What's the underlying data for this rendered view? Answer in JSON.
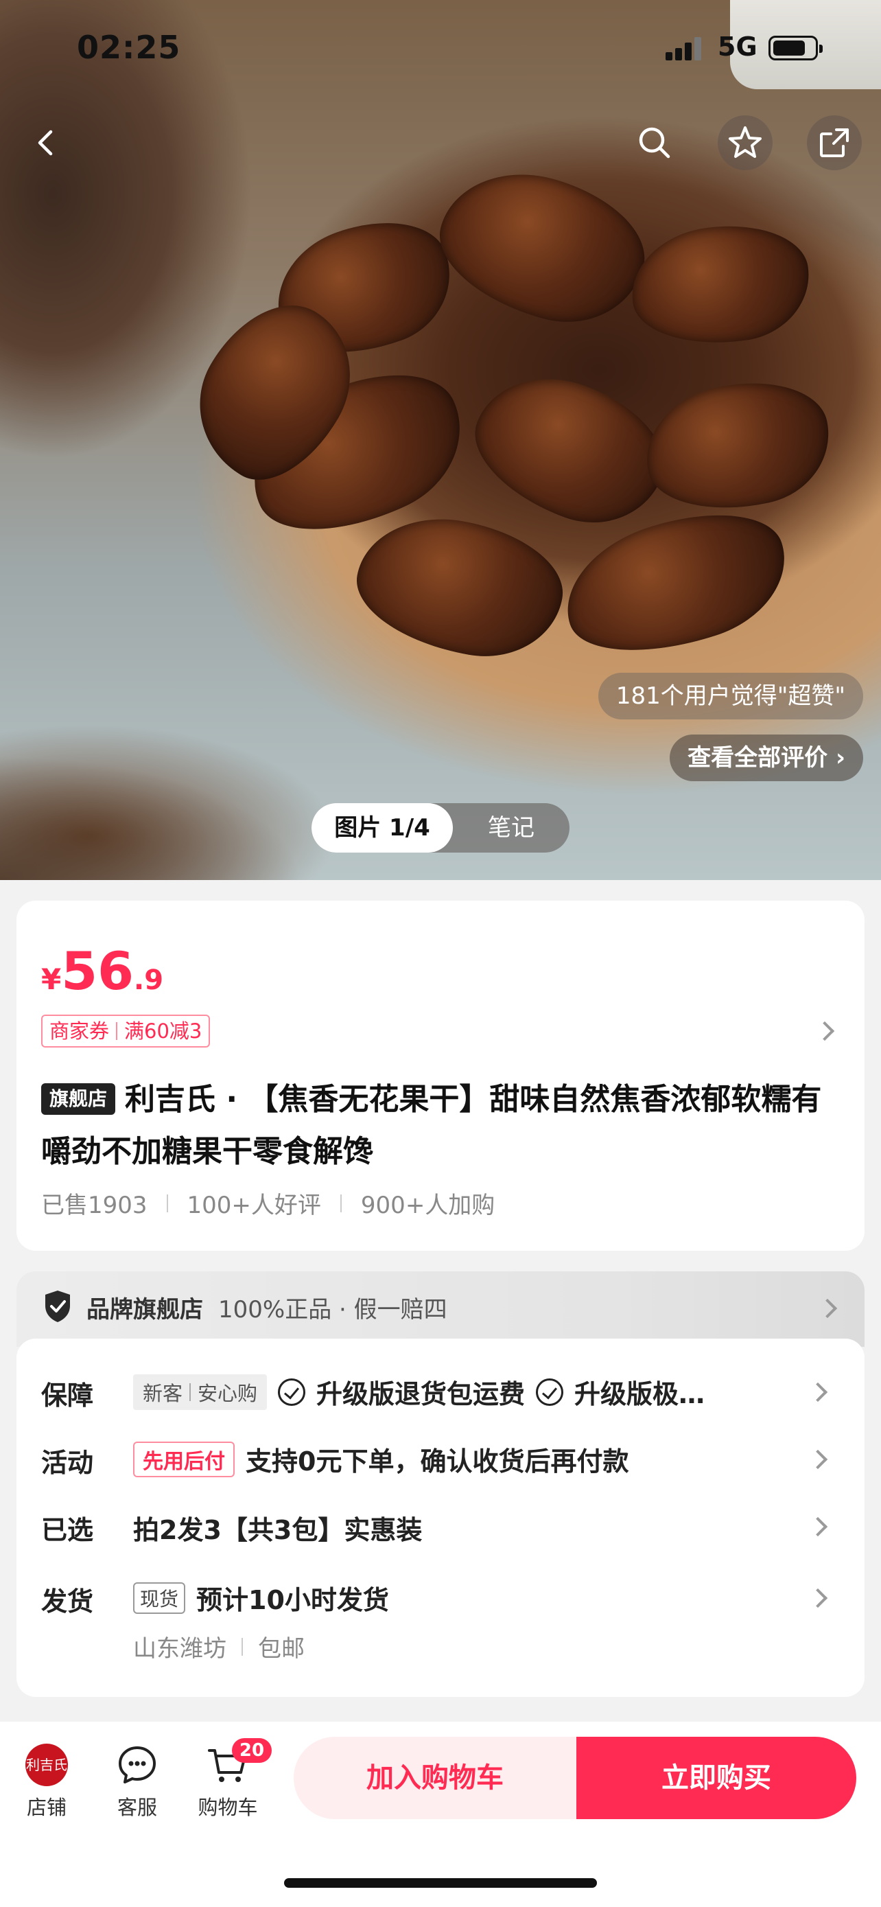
{
  "status_bar": {
    "time": "02:25",
    "network": "5G",
    "battery_level": 0.8
  },
  "media": {
    "praise_text": "181个用户觉得\"超赞\"",
    "reviews_link": "查看全部评价 ›",
    "tab_photo": "图片 1/4",
    "tab_notes": "笔记"
  },
  "product": {
    "price_currency": "¥",
    "price_int": "56",
    "price_dec": ".9",
    "coupon_label": "商家券",
    "coupon_value": "满60减3",
    "store_flag": "旗舰店",
    "title": "利吉氏 · 【焦香无花果干】甜味自然焦香浓郁软糯有嚼劲不加糖果干零食解馋",
    "sold": "已售1903",
    "good_reviews": "100+人好评",
    "added_to_cart": "900+人加购"
  },
  "brand_banner": {
    "label": "品牌旗舰店",
    "sub": "100%正品 · 假一赔四"
  },
  "info": {
    "guarantee": {
      "label": "保障",
      "tag_a": "新客",
      "tag_b": "安心购",
      "item1": "升级版退货包运费",
      "item2": "升级版极…"
    },
    "activity": {
      "label": "活动",
      "tag": "先用后付",
      "text": "支持0元下单，确认收货后再付款"
    },
    "selected": {
      "label": "已选",
      "text": "拍2发3【共3包】实惠装"
    },
    "shipping": {
      "label": "发货",
      "tag": "现货",
      "text": "预计10小时发货",
      "origin": "山东潍坊",
      "shipping_fee": "包邮"
    }
  },
  "bottom_bar": {
    "store_logo_text": "利吉氏",
    "store": "店铺",
    "service": "客服",
    "cart": "购物车",
    "cart_count": "20",
    "add_to_cart": "加入购物车",
    "buy_now": "立即购买"
  },
  "colors": {
    "accent": "#ff2b52",
    "accent_soft": "#ffeef0"
  },
  "icons": [
    "back-icon",
    "search-icon",
    "star-icon",
    "share-icon",
    "shield-icon",
    "check-icon",
    "chat-icon",
    "cart-icon",
    "chevron-right-icon"
  ]
}
